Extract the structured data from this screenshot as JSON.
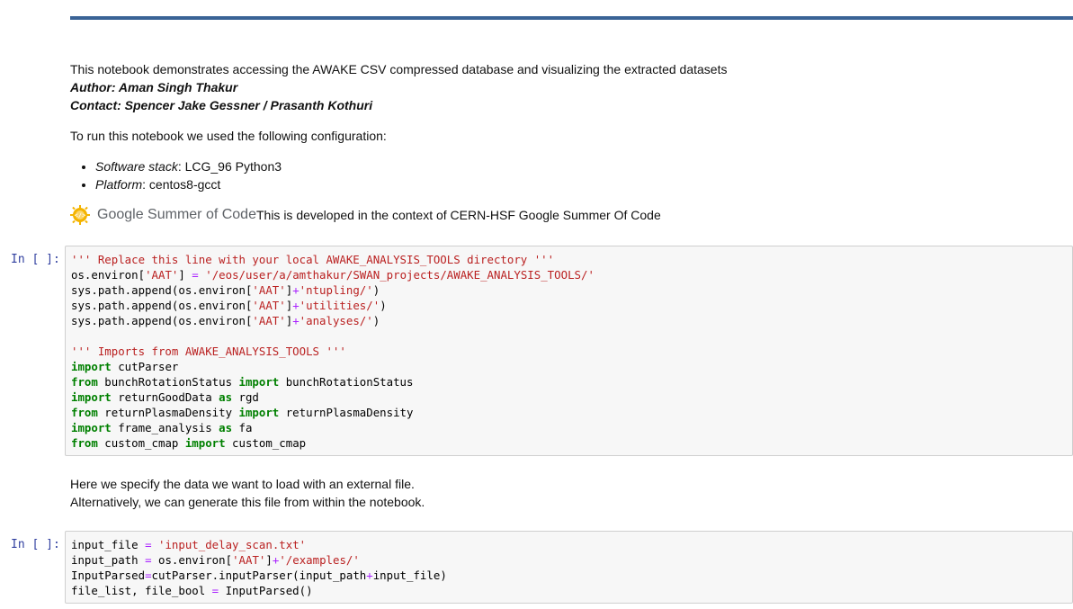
{
  "intro": {
    "description": "This notebook demonstrates accessing the AWAKE CSV compressed database and visualizing the extracted datasets",
    "author": "Author: Aman Singh Thakur",
    "contact": "Contact: Spencer Jake Gessner / Prasanth Kothuri",
    "config_intro": "To run this notebook we used the following configuration:",
    "config": [
      {
        "key": "Software stack",
        "value": ": LCG_96 Python3"
      },
      {
        "key": "Platform",
        "value": ": centos8-gcct"
      }
    ],
    "gsoc_logo_text": "Google Summer of Code",
    "gsoc_text": "This is developed in the context of CERN-HSF Google Summer Of Code"
  },
  "cells": {
    "cell1": {
      "prompt": "In [ ]:",
      "lines": [
        [
          [
            "str",
            "''' Replace this line with your local AWAKE_ANALYSIS_TOOLS directory '''"
          ]
        ],
        [
          [
            "",
            "os.environ["
          ],
          [
            "str",
            "'AAT'"
          ],
          [
            "",
            "] "
          ],
          [
            "op",
            "="
          ],
          [
            "",
            " "
          ],
          [
            "str",
            "'/eos/user/a/amthakur/SWAN_projects/AWAKE_ANALYSIS_TOOLS/'"
          ]
        ],
        [
          [
            "",
            "sys.path.append(os.environ["
          ],
          [
            "str",
            "'AAT'"
          ],
          [
            "",
            "]"
          ],
          [
            "op",
            "+"
          ],
          [
            "str",
            "'ntupling/'"
          ],
          [
            "",
            ")"
          ]
        ],
        [
          [
            "",
            "sys.path.append(os.environ["
          ],
          [
            "str",
            "'AAT'"
          ],
          [
            "",
            "]"
          ],
          [
            "op",
            "+"
          ],
          [
            "str",
            "'utilities/'"
          ],
          [
            "",
            ")"
          ]
        ],
        [
          [
            "",
            "sys.path.append(os.environ["
          ],
          [
            "str",
            "'AAT'"
          ],
          [
            "",
            "]"
          ],
          [
            "op",
            "+"
          ],
          [
            "str",
            "'analyses/'"
          ],
          [
            "",
            ")"
          ]
        ],
        [
          [
            "",
            ""
          ]
        ],
        [
          [
            "str",
            "''' Imports from AWAKE_ANALYSIS_TOOLS '''"
          ]
        ],
        [
          [
            "kw",
            "import"
          ],
          [
            "",
            " cutParser"
          ]
        ],
        [
          [
            "kw",
            "from"
          ],
          [
            "",
            " bunchRotationStatus "
          ],
          [
            "kw",
            "import"
          ],
          [
            "",
            " bunchRotationStatus"
          ]
        ],
        [
          [
            "kw",
            "import"
          ],
          [
            "",
            " returnGoodData "
          ],
          [
            "kw",
            "as"
          ],
          [
            "",
            " rgd"
          ]
        ],
        [
          [
            "kw",
            "from"
          ],
          [
            "",
            " returnPlasmaDensity "
          ],
          [
            "kw",
            "import"
          ],
          [
            "",
            " returnPlasmaDensity"
          ]
        ],
        [
          [
            "kw",
            "import"
          ],
          [
            "",
            " frame_analysis "
          ],
          [
            "kw",
            "as"
          ],
          [
            "",
            " fa"
          ]
        ],
        [
          [
            "kw",
            "from"
          ],
          [
            "",
            " custom_cmap "
          ],
          [
            "kw",
            "import"
          ],
          [
            "",
            " custom_cmap"
          ]
        ]
      ]
    },
    "cell2": {
      "prompt": "In [ ]:",
      "lines": [
        [
          [
            "",
            "input_file "
          ],
          [
            "op",
            "="
          ],
          [
            "",
            " "
          ],
          [
            "str",
            "'input_delay_scan.txt'"
          ]
        ],
        [
          [
            "",
            "input_path "
          ],
          [
            "op",
            "="
          ],
          [
            "",
            " os.environ["
          ],
          [
            "str",
            "'AAT'"
          ],
          [
            "",
            "]"
          ],
          [
            "op",
            "+"
          ],
          [
            "str",
            "'/examples/'"
          ]
        ],
        [
          [
            "",
            "InputParsed"
          ],
          [
            "op",
            "="
          ],
          [
            "",
            "cutParser.inputParser(input_path"
          ],
          [
            "op",
            "+"
          ],
          [
            "",
            "input_file)"
          ]
        ],
        [
          [
            "",
            "file_list, file_bool "
          ],
          [
            "op",
            "="
          ],
          [
            "",
            " InputParsed()"
          ]
        ]
      ]
    }
  },
  "between": {
    "line1": "Here we specify the data we want to load with an external file.",
    "line2": "Alternatively, we can generate this file from within the notebook."
  },
  "colors": {
    "header_rule": "#3a6396",
    "prompt": "#303f9f",
    "keyword": "#008000",
    "string": "#ba2121",
    "operator": "#aa22ff",
    "cell_bg": "#f7f7f7"
  }
}
